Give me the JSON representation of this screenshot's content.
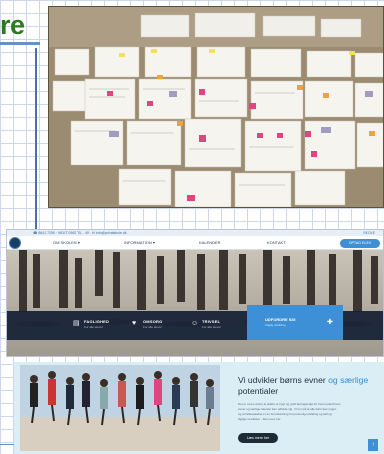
{
  "heading": {
    "text": "re"
  },
  "website": {
    "topbar": {
      "contact": "☎ 8641 7255 · NEUT 0962 TIL ∙ 49 · ✉ info@privatskole.dk",
      "right": "SKOLE"
    },
    "nav": {
      "items": [
        "OM SKOLEN ▾",
        "INFORMATION ▾",
        "KALENDER",
        "KONTAKT"
      ],
      "cta": "OPTAG ELEV"
    },
    "features": [
      {
        "icon": "book-icon",
        "glyph": "▤",
        "title": "FAGLIGHED",
        "subtitle": "For alle elever"
      },
      {
        "icon": "heart-icon",
        "glyph": "♥",
        "title": "OMSORG",
        "subtitle": "For alle elever"
      },
      {
        "icon": "smile-icon",
        "glyph": "☺",
        "title": "TRIVSEL",
        "subtitle": "For alle elever"
      }
    ],
    "feature_active": {
      "title": "UDFORDRE SIG",
      "subtitle": "Faglig udvikling",
      "glyph": "✚"
    }
  },
  "lower": {
    "title_line1": "Vi udvikler børns evner",
    "title_accent1": " og særlige",
    "title_line2_accent": "potentialer",
    "body": [
      "Det er vores vision at skabe et trygt og godt læringsmiljø for hvert enkelt barn",
      "evner og særlige talenter kan udfolde sig. Vi tror på at alle børn kan noget,",
      "og at fællesskabet er en forudsætning for personlig udvikling og læring.",
      "faglige resultater - læs mere her."
    ],
    "button": "Læs mere her",
    "scroll_top": "↑"
  },
  "colors": {
    "heading_green": "#2b7a1f",
    "brand_blue": "#3d8fd6",
    "navy": "#142034",
    "light_panel": "#dbeef6"
  }
}
